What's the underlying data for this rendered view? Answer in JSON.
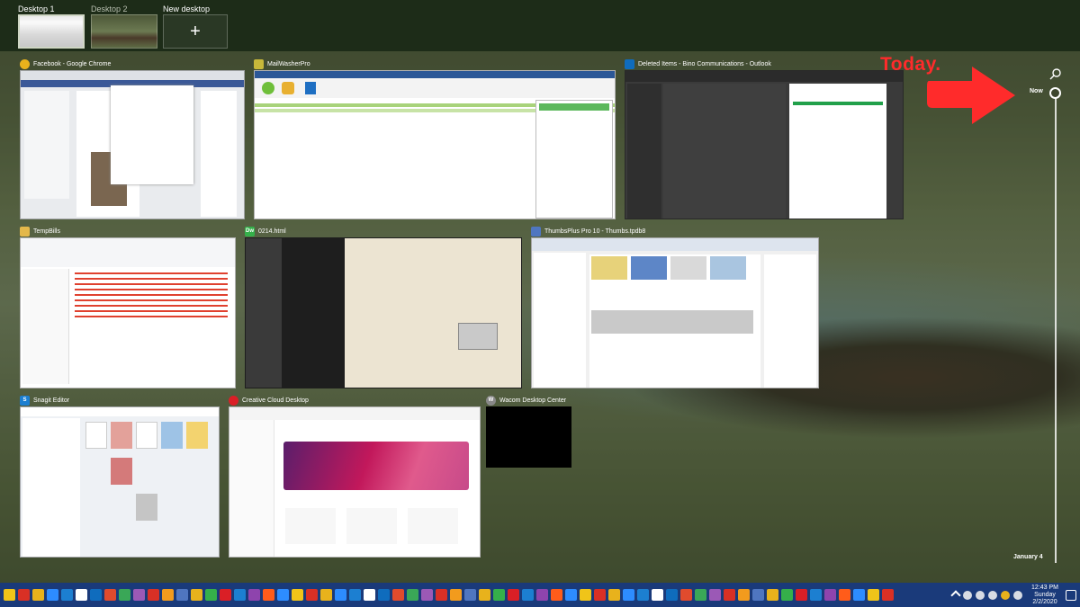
{
  "desktops": [
    {
      "label": "Desktop 1",
      "active": true
    },
    {
      "label": "Desktop 2",
      "active": false
    },
    {
      "label": "New desktop",
      "plus": "+"
    }
  ],
  "windows": [
    {
      "title": "Facebook - Google Chrome",
      "icon": "chrome-icon",
      "color": "#e8b21c"
    },
    {
      "title": "MailWasherPro",
      "icon": "mailwasher-icon",
      "color": "#c8b83a"
    },
    {
      "title": "Deleted Items - Bino Communications - Outlook",
      "icon": "outlook-icon",
      "color": "#0f6cbd"
    },
    {
      "title": "TempBills",
      "icon": "folder-icon",
      "color": "#e4b84b"
    },
    {
      "title": "0214.html",
      "icon": "dreamweaver-icon",
      "glyph": "Dw",
      "color": "#35b04a"
    },
    {
      "title": "ThumbsPlus Pro 10 - Thumbs.tpdb8",
      "icon": "thumbsplus-icon",
      "color": "#4f76c0"
    },
    {
      "title": "Snagit Editor",
      "icon": "snagit-icon",
      "glyph": "S",
      "color": "#1c7fd1"
    },
    {
      "title": "Creative Cloud Desktop",
      "icon": "creative-cloud-icon",
      "color": "#da1f26"
    },
    {
      "title": "Wacom Desktop Center",
      "icon": "wacom-icon",
      "glyph": "W",
      "color": "#888888"
    }
  ],
  "annotation": {
    "text": "Today."
  },
  "timeline": {
    "now_label": "Now",
    "bottom_label": "January 4"
  },
  "clock": {
    "time": "12:43 PM",
    "day": "Sunday",
    "date": "2/2/2020"
  },
  "colors": {
    "annotation": "#ff2b2b",
    "taskbar": "#1a3a7a",
    "desktop_bar": "#16261488"
  }
}
